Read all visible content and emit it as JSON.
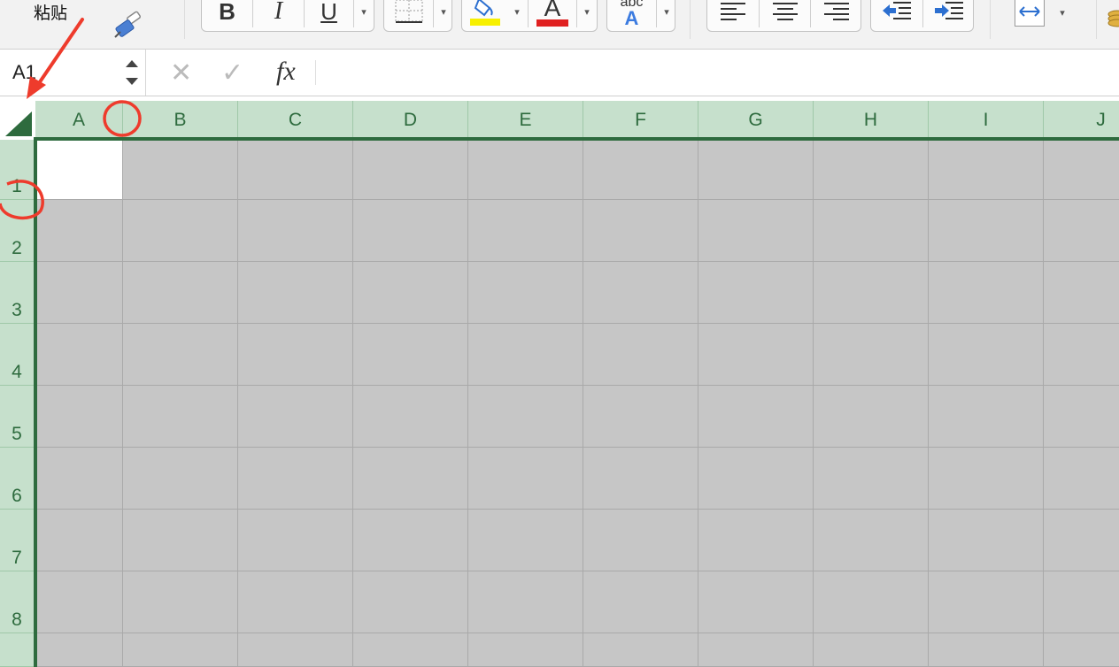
{
  "ribbon": {
    "paste_label": "粘贴",
    "bold": "B",
    "italic": "I",
    "underline": "U",
    "font_color_letter": "A",
    "phonetic_top": "abc",
    "phonetic_bottom": "A",
    "dropdown_glyph": "▾"
  },
  "colors": {
    "header_bg": "#c6e0cc",
    "header_text": "#2e6b3e",
    "selection_fill": "#c6c6c6",
    "highlight_yellow": "#f7f000",
    "font_red": "#e02020",
    "annotation_red": "#ee3b2c",
    "accent_green": "#2e6b3e"
  },
  "formula_bar": {
    "name_box_value": "A1",
    "cancel_glyph": "✕",
    "confirm_glyph": "✓",
    "fx_label": "fx",
    "formula_value": ""
  },
  "sheet": {
    "columns": [
      "A",
      "B",
      "C",
      "D",
      "E",
      "F",
      "G",
      "H",
      "I",
      "J"
    ],
    "rows": [
      "1",
      "2",
      "3",
      "4",
      "5",
      "6",
      "7",
      "8"
    ],
    "active_cell": "A1",
    "selection": "all"
  },
  "annotations": {
    "arrow_target": "select-all-corner",
    "circles": [
      "column-A-B-border",
      "row-1-header"
    ]
  }
}
